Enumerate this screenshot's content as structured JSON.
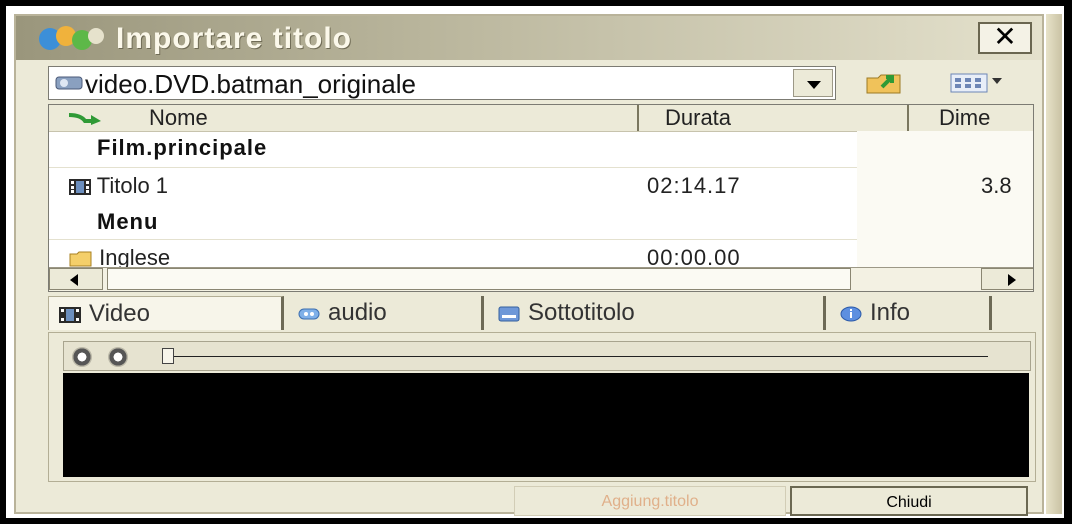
{
  "window": {
    "title": "Importare titolo",
    "close_label": "✕"
  },
  "path_combo": {
    "value": "video.DVD.batman_originale"
  },
  "list": {
    "columns": [
      "Nome",
      "Durata",
      "Dime"
    ],
    "groups": [
      {
        "label": "Film.principale",
        "items": [
          {
            "name": "Titolo 1",
            "duration": "02:14.17",
            "dim": "3.8",
            "icon": "film-icon"
          }
        ]
      },
      {
        "label": "Menu",
        "items": [
          {
            "name": "Inglese",
            "duration": "00:00.00",
            "dim": "",
            "icon": "folder-icon"
          }
        ]
      }
    ]
  },
  "tabs": [
    {
      "label": "Video",
      "icon": "film-icon"
    },
    {
      "label": "audio",
      "icon": "audio-icon"
    },
    {
      "label": "Sottotitolo",
      "icon": "subtitle-icon"
    },
    {
      "label": "Info",
      "icon": "info-icon"
    }
  ],
  "buttons": {
    "add_title": "Aggiung.titolo",
    "close": "Chiudi"
  },
  "colors": {
    "window_bg": "#ecead8",
    "title_text": "#fbf8ea",
    "disabled_text": "#e0b08a"
  }
}
